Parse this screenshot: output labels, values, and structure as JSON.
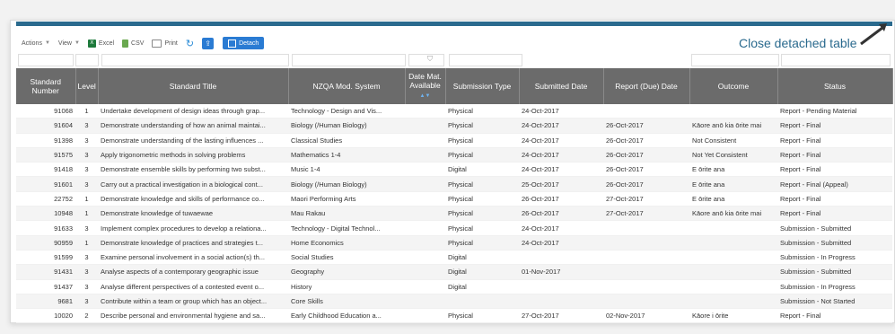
{
  "toolbar": {
    "actions_label": "Actions",
    "view_label": "View",
    "excel_label": "Excel",
    "csv_label": "CSV",
    "print_label": "Print",
    "detach_label": "Detach"
  },
  "close_link": "Close detached table",
  "colors": {
    "header_bg": "#6b6b6b",
    "accent": "#2a6a8e",
    "button": "#2a7bd3"
  },
  "columns": [
    "Standard Number",
    "Level",
    "Standard Title",
    "NZQA Mod. System",
    "Date Mat. Available",
    "Submission Type",
    "Submitted Date",
    "Report (Due) Date",
    "Outcome",
    "Status"
  ],
  "rows": [
    [
      "91068",
      "1",
      "Undertake development of design ideas through grap...",
      "Technology - Design and Vis...",
      "",
      "Physical",
      "24-Oct-2017",
      "",
      "",
      "Report - Pending Material"
    ],
    [
      "91604",
      "3",
      "Demonstrate understanding of how an animal maintai...",
      "Biology (/Human Biology)",
      "",
      "Physical",
      "24-Oct-2017",
      "26-Oct-2017",
      "Kāore anō kia ōrite mai",
      "Report - Final"
    ],
    [
      "91398",
      "3",
      "Demonstrate understanding of the lasting influences ...",
      "Classical Studies",
      "",
      "Physical",
      "24-Oct-2017",
      "26-Oct-2017",
      "Not Consistent",
      "Report - Final"
    ],
    [
      "91575",
      "3",
      "Apply trigonometric methods in solving problems",
      "Mathematics 1-4",
      "",
      "Physical",
      "24-Oct-2017",
      "26-Oct-2017",
      "Not Yet Consistent",
      "Report - Final"
    ],
    [
      "91418",
      "3",
      "Demonstrate ensemble skills by performing two subst...",
      "Music 1-4",
      "",
      "Digital",
      "24-Oct-2017",
      "26-Oct-2017",
      "E ōrite ana",
      "Report - Final"
    ],
    [
      "91601",
      "3",
      "Carry out a practical investigation in a biological cont...",
      "Biology (/Human Biology)",
      "",
      "Physical",
      "25-Oct-2017",
      "26-Oct-2017",
      "E ōrite ana",
      "Report - Final (Appeal)"
    ],
    [
      "22752",
      "1",
      "Demonstrate knowledge and skills of performance co...",
      "Maori Performing Arts",
      "",
      "Physical",
      "26-Oct-2017",
      "27-Oct-2017",
      "E ōrite ana",
      "Report - Final"
    ],
    [
      "10948",
      "1",
      "Demonstrate knowledge of tuwaewae",
      "Mau Rakau",
      "",
      "Physical",
      "26-Oct-2017",
      "27-Oct-2017",
      "Kāore anō kia ōrite mai",
      "Report - Final"
    ],
    [
      "91633",
      "3",
      "Implement complex procedures to develop a relationa...",
      "Technology - Digital Technol...",
      "",
      "Physical",
      "24-Oct-2017",
      "",
      "",
      "Submission - Submitted"
    ],
    [
      "90959",
      "1",
      "Demonstrate knowledge of practices and strategies t...",
      "Home Economics",
      "",
      "Physical",
      "24-Oct-2017",
      "",
      "",
      "Submission - Submitted"
    ],
    [
      "91599",
      "3",
      "Examine personal involvement in a social action(s) th...",
      "Social Studies",
      "",
      "Digital",
      "",
      "",
      "",
      "Submission - In Progress"
    ],
    [
      "91431",
      "3",
      "Analyse aspects of a contemporary geographic issue",
      "Geography",
      "",
      "Digital",
      "01-Nov-2017",
      "",
      "",
      "Submission - Submitted"
    ],
    [
      "91437",
      "3",
      "Analyse different perspectives of a contested event o...",
      "History",
      "",
      "Digital",
      "",
      "",
      "",
      "Submission - In Progress"
    ],
    [
      "9681",
      "3",
      "Contribute within a team or group which has an object...",
      "Core Skills",
      "",
      "",
      "",
      "",
      "",
      "Submission - Not Started"
    ],
    [
      "10020",
      "2",
      "Describe personal and environmental hygiene and sa...",
      "Early Childhood Education a...",
      "",
      "Physical",
      "27-Oct-2017",
      "02-Nov-2017",
      "Kāore i ōrite",
      "Report - Final"
    ]
  ]
}
